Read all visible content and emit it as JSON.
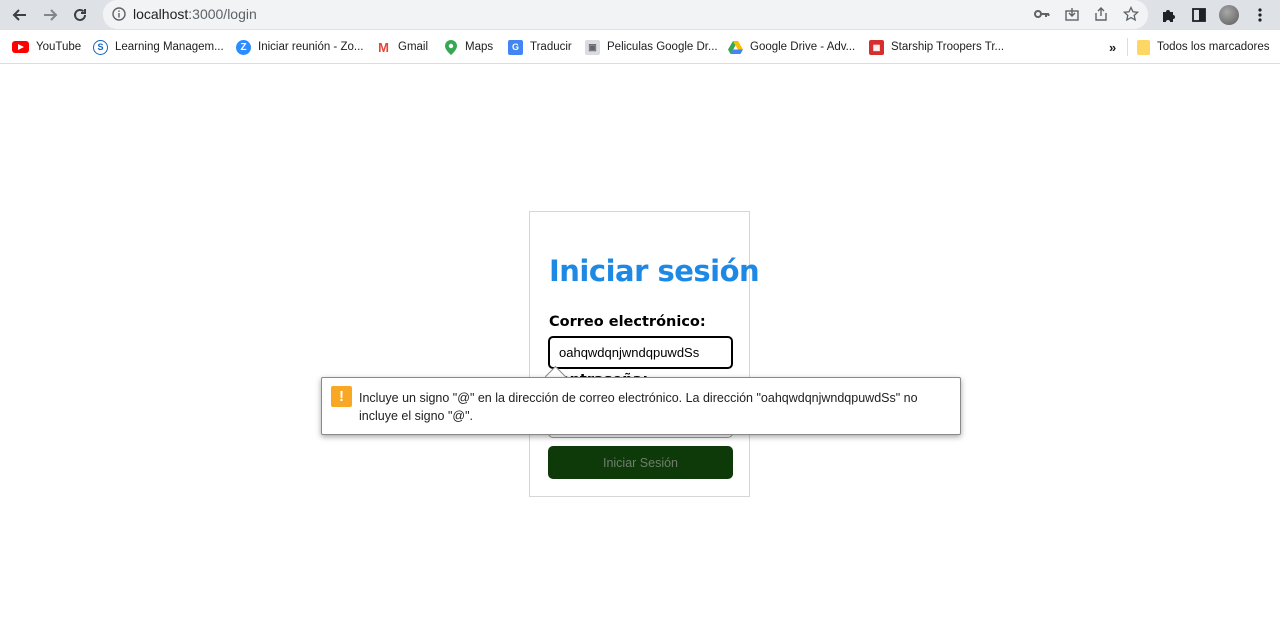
{
  "browser": {
    "url_host": "localhost",
    "url_path": ":3000/login",
    "bookmarks": [
      {
        "label": "YouTube",
        "icon": "youtube-icon",
        "color": "#ff0000"
      },
      {
        "label": "Learning Managem...",
        "icon": "lms-icon",
        "color": "#1565c0"
      },
      {
        "label": "Iniciar reunión - Zo...",
        "icon": "zoom-icon",
        "color": "#2d8cff"
      },
      {
        "label": "Gmail",
        "icon": "gmail-icon",
        "color": "#ea4335"
      },
      {
        "label": "Maps",
        "icon": "maps-icon",
        "color": "#34a853"
      },
      {
        "label": "Traducir",
        "icon": "translate-icon",
        "color": "#4285f4"
      },
      {
        "label": "Peliculas Google Dr...",
        "icon": "film-icon",
        "color": "#5f6368"
      },
      {
        "label": "Google Drive - Adv...",
        "icon": "drive-icon",
        "color": "#fbbc04"
      },
      {
        "label": "Starship Troopers Tr...",
        "icon": "clapper-icon",
        "color": "#d32f2f"
      }
    ],
    "overflow_label": "»",
    "all_bookmarks_label": "Todos los marcadores"
  },
  "login": {
    "title": "Iniciar sesión",
    "email_label": "Correo electrónico:",
    "email_value": "oahqwdqnjwndqpuwdSs",
    "password_label": "Contraseña:",
    "submit_label": "Iniciar Sesión"
  },
  "validation": {
    "message": "Incluye un signo \"@\" en la dirección de correo electrónico. La dirección \"oahqwdqnjwndqpuwdSs\" no incluye el signo \"@\".",
    "icon": "!"
  },
  "colors": {
    "title": "#1e88e5",
    "button_bg": "#0e3a0a",
    "warning": "#f9a825"
  }
}
